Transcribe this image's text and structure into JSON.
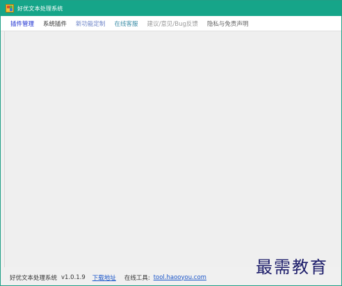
{
  "window": {
    "title": "好优文本处理系统",
    "icon": "app-icon"
  },
  "menu": {
    "items": [
      {
        "label": "插件管理",
        "color": "#1a2dd0"
      },
      {
        "label": "系统插件",
        "color": "#333333"
      },
      {
        "label": "新功能定制",
        "color": "#6f86c8"
      },
      {
        "label": "在线客服",
        "color": "#3f8fa8"
      },
      {
        "label": "建议/意见/Bug反馈",
        "color": "#9a9a9a"
      },
      {
        "label": "隐私与免责声明",
        "color": "#666666"
      }
    ]
  },
  "status": {
    "app_name": "好优文本处理系统",
    "version": "v1.0.1.9",
    "download_link": "下载地址",
    "online_tools_label": "在线工具:",
    "online_tools_url": "tool.haooyou.com"
  },
  "watermark": {
    "text": "最需教育"
  }
}
